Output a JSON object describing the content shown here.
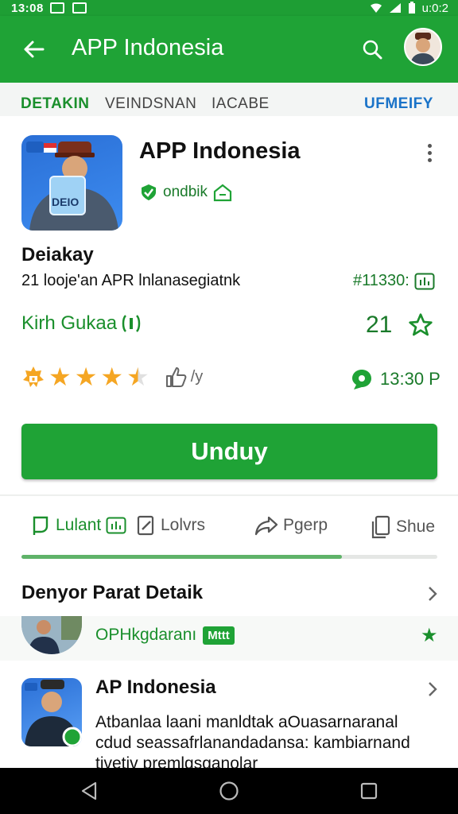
{
  "status_bar": {
    "time": "13:08",
    "battery_text": "u:0:2"
  },
  "app_bar": {
    "title": "APP Indonesia"
  },
  "tabs": [
    {
      "label": "DETAKIN",
      "active": true
    },
    {
      "label": "VEINDSNAN"
    },
    {
      "label": "IACABE"
    },
    {
      "label": "UFMEIFY"
    }
  ],
  "app": {
    "name": "APP Indonesia",
    "developer": "ondbik",
    "icon_text": "DEIO"
  },
  "details": {
    "title": "Deiakay",
    "subtitle": "21 looje'an APR lnlanasegiatnk",
    "code": "#11330:",
    "link_label": "Kirh Gukaa",
    "count": "21",
    "rating_stars": 3.5,
    "rating_extra": "/y",
    "time": "13:30 P"
  },
  "install_button": {
    "label": "Unduy"
  },
  "actions": [
    {
      "label": "Lulant",
      "icon": "bookmark-icon"
    },
    {
      "label": "Lolvrs",
      "icon": "edit-icon"
    },
    {
      "label": "Pgerp",
      "icon": "share-arrow-icon"
    },
    {
      "label": "Shue",
      "icon": "copy-icon"
    }
  ],
  "progress": {
    "fraction": 0.77
  },
  "similar": {
    "title": "Denyor Parat Detaik",
    "items": [
      {
        "name": "OPHkgdaranı",
        "badge": "Mttt"
      },
      {
        "name": "AP Indonesia",
        "description": "Atbanlaa laani manldtak aOuasarnaranal cdud seassafrlanandadansa: kambiarnand tivetiv premlgsganolar"
      }
    ]
  },
  "colors": {
    "primary": "#1fa336",
    "accent": "#1a8f2c",
    "star": "#f5a623",
    "link_blue": "#1a73c8"
  }
}
